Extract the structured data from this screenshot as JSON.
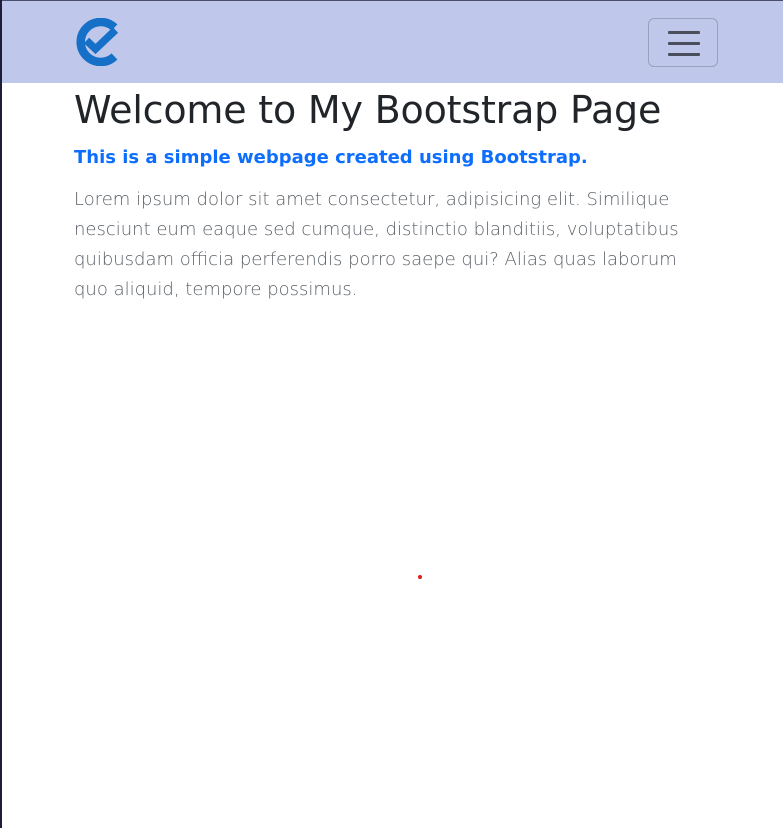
{
  "navbar": {
    "logo_icon": "check-circle-logo-icon",
    "toggler_icon": "hamburger-menu-icon",
    "background_color": "#bfc7ea",
    "logo_color": "#1670c8"
  },
  "main": {
    "title": "Welcome to My Bootstrap Page",
    "subtitle": "This is a simple webpage created using Bootstrap.",
    "lead": "Lorem ipsum dolor sit amet consectetur, adipisicing elit. Similique nesciunt eum eaque sed cumque, distinctio blanditiis, voluptatibus quibusdam officia perferendis porro saepe qui? Alias quas laborum quo aliquid, tempore possimus.",
    "subtitle_color": "#0d6efd"
  }
}
